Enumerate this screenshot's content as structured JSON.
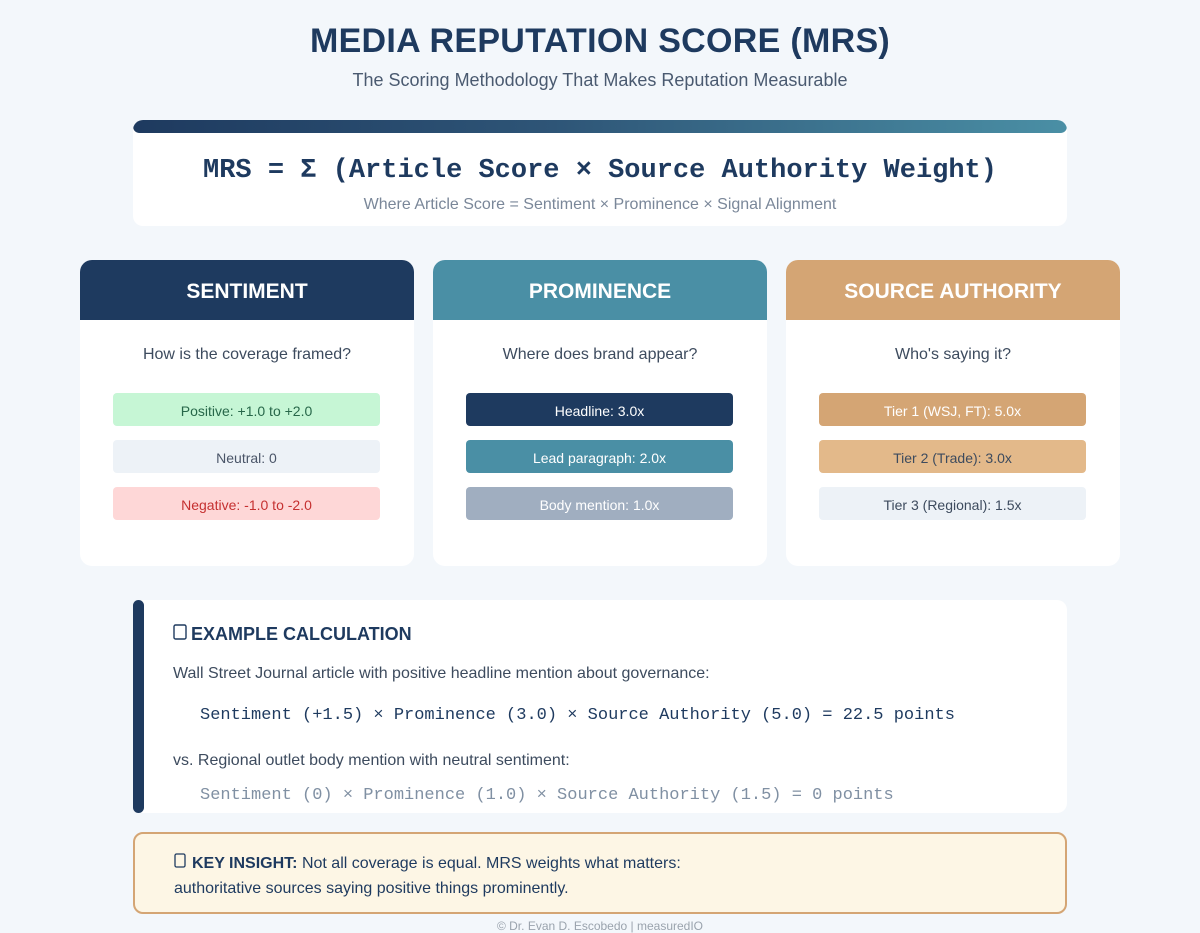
{
  "header": {
    "title": "MEDIA REPUTATION SCORE (MRS)",
    "subtitle": "The Scoring Methodology That Makes Reputation Measurable"
  },
  "formula": {
    "main": "MRS = Σ (Article Score × Source Authority Weight)",
    "sub": "Where Article Score = Sentiment × Prominence × Signal Alignment"
  },
  "columns": [
    {
      "title": "SENTIMENT",
      "question": "How is the coverage framed?",
      "header_color": "#1e3a5f",
      "items": [
        {
          "label": "Positive: +1.0 to +2.0",
          "bg": "#c6f6d5",
          "fg": "#276749"
        },
        {
          "label": "Neutral: 0",
          "bg": "#edf2f7",
          "fg": "#4a5568"
        },
        {
          "label": "Negative: -1.0 to -2.0",
          "bg": "#fed7d7",
          "fg": "#c53030"
        }
      ]
    },
    {
      "title": "PROMINENCE",
      "question": "Where does brand appear?",
      "header_color": "#4a8fa5",
      "items": [
        {
          "label": "Headline: 3.0x",
          "bg": "#1e3a5f",
          "fg": "#ffffff"
        },
        {
          "label": "Lead paragraph: 2.0x",
          "bg": "#4a8fa5",
          "fg": "#ffffff"
        },
        {
          "label": "Body mention: 1.0x",
          "bg": "#a0aec0",
          "fg": "#ffffff"
        }
      ]
    },
    {
      "title": "SOURCE AUTHORITY",
      "question": "Who's saying it?",
      "header_color": "#d4a574",
      "items": [
        {
          "label": "Tier 1 (WSJ, FT): 5.0x",
          "bg": "#d4a574",
          "fg": "#ffffff"
        },
        {
          "label": "Tier 2 (Trade): 3.0x",
          "bg": "#e3b98a",
          "fg": "#3d4b5e"
        },
        {
          "label": "Tier 3 (Regional): 1.5x",
          "bg": "#edf2f7",
          "fg": "#3d4b5e"
        }
      ]
    }
  ],
  "example": {
    "icon": "calculator-icon",
    "title": "EXAMPLE CALCULATION",
    "line1": "Wall Street Journal article with positive headline mention about governance:",
    "calc1": "Sentiment (+1.5) × Prominence (3.0) × Source Authority (5.0) = 22.5 points",
    "line2": "vs. Regional outlet body mention with neutral sentiment:",
    "calc2": "Sentiment (0) × Prominence (1.0) × Source Authority (1.5) = 0 points"
  },
  "insight": {
    "icon": "lightbulb-icon",
    "label": "KEY INSIGHT:",
    "text1": " Not all coverage is equal. MRS weights what matters:",
    "text2": "authoritative sources saying positive things prominently."
  },
  "footer": "© Dr. Evan D. Escobedo | measuredIO"
}
